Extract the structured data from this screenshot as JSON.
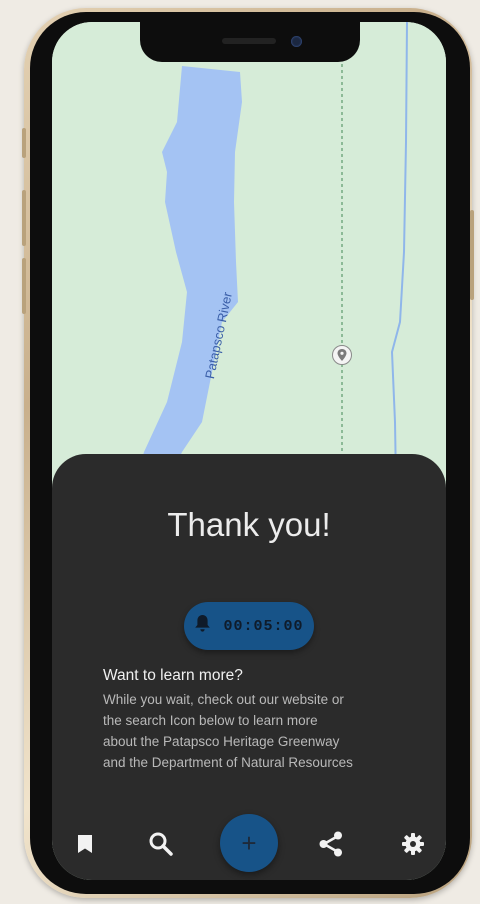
{
  "map": {
    "river_label": "Patapsco River",
    "pin_icon": "place-marker-icon",
    "colors": {
      "land": "#d6ecd8",
      "water": "#a4c3f3",
      "trail": "#5c9a6c",
      "stream": "#8fb6ea"
    }
  },
  "sheet": {
    "title": "Thank you!",
    "timer": {
      "icon": "bell-icon",
      "value": "00:05:00"
    },
    "learn_more": {
      "title": "Want to learn more?",
      "lines": [
        "While you wait, check out our website or",
        "the search Icon below to learn more",
        "about the Patapsco Heritage Greenway",
        "and the Department of Natural Resources"
      ]
    }
  },
  "nav": {
    "items": [
      {
        "name": "bookmark",
        "icon": "bookmark-icon"
      },
      {
        "name": "search",
        "icon": "search-icon"
      },
      {
        "name": "add",
        "icon": "plus-icon",
        "label": "+"
      },
      {
        "name": "share",
        "icon": "share-icon"
      },
      {
        "name": "settings",
        "icon": "gear-icon"
      }
    ]
  },
  "theme": {
    "accent": "#175388",
    "sheet_bg": "#2b2b2b",
    "page_bg": "#efebe4"
  }
}
